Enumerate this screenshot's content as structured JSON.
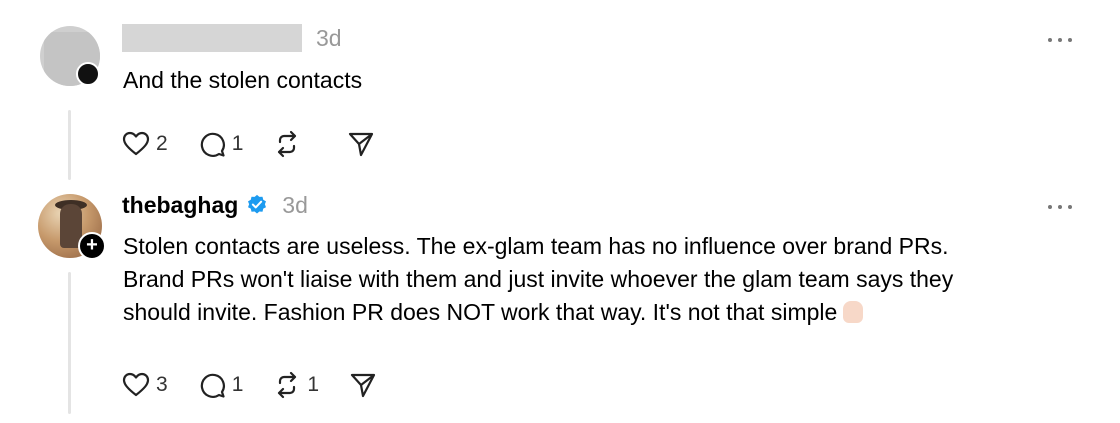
{
  "posts": [
    {
      "username": "",
      "timestamp": "3d",
      "text": "And the stolen contacts",
      "likes": "2",
      "replies": "1",
      "reposts": "",
      "avatar": "redacted",
      "icons": [
        "heart-icon",
        "comment-icon",
        "repost-icon",
        "share-icon",
        "more-icon"
      ]
    },
    {
      "username": "thebaghag",
      "verified": true,
      "timestamp": "3d",
      "text_lines": [
        "Stolen contacts are useless. The ex-glam team has no influence over brand PRs.",
        "Brand PRs won't liaise with them and just invite whoever the glam team says they",
        "should invite. Fashion PR does NOT work that way. It's not that simple"
      ],
      "emoji": "victory-hand",
      "likes": "3",
      "replies": "1",
      "reposts": "1",
      "verified_color": "#1d9bf0"
    }
  ]
}
